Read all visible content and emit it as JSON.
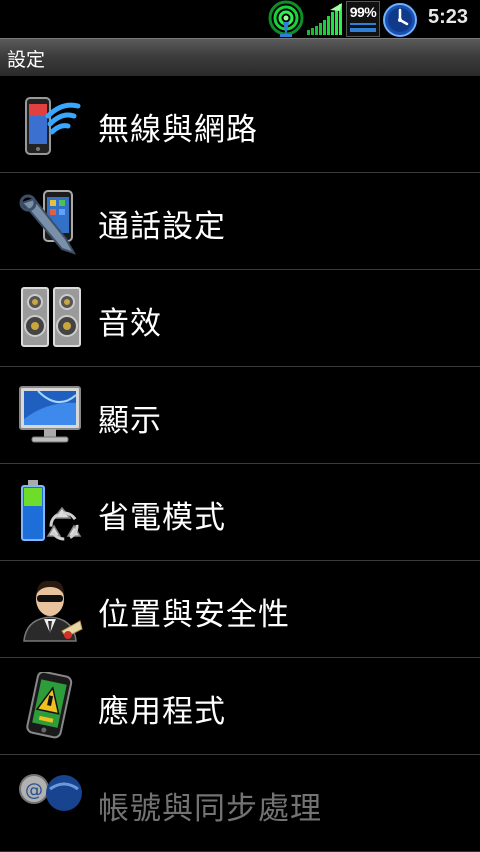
{
  "status_bar": {
    "battery_percent": "99%",
    "time": "5:23",
    "icons": [
      "wifi-icon",
      "signal-strength-icon",
      "battery-icon",
      "clock-icon"
    ]
  },
  "title_bar": {
    "title": "設定"
  },
  "menu": {
    "items": [
      {
        "label": "無線與網路",
        "icon": "wireless-network-icon"
      },
      {
        "label": "通話設定",
        "icon": "call-settings-icon"
      },
      {
        "label": "音效",
        "icon": "speaker-icon"
      },
      {
        "label": "顯示",
        "icon": "monitor-icon"
      },
      {
        "label": "省電模式",
        "icon": "battery-recycle-icon"
      },
      {
        "label": "位置與安全性",
        "icon": "security-agent-icon"
      },
      {
        "label": "應用程式",
        "icon": "applications-phone-icon"
      },
      {
        "label": "帳號與同步處理",
        "icon": "accounts-sync-icon"
      }
    ]
  },
  "colors": {
    "background": "#000000",
    "title_bar": "#3d3d3d",
    "divider": "#3a3a3a",
    "accent_blue": "#2f7fd6",
    "wifi_green": "#19d23a"
  }
}
